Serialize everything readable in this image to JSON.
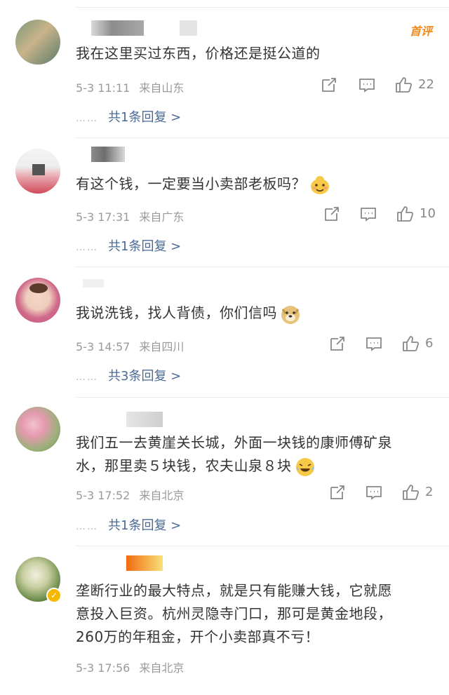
{
  "comments": [
    {
      "badge": "首评",
      "text": "我在这里买过东西，价格还是挺公道的",
      "date": "5-3 11:11",
      "location": "来自山东",
      "likes": "22",
      "reply_link": "共1条回复 >"
    },
    {
      "text": "有这个钱，一定要当小卖部老板吗？",
      "emoji": "smiling-face-emoji",
      "date": "5-3 17:31",
      "location": "来自广东",
      "likes": "10",
      "reply_link": "共1条回复 >"
    },
    {
      "text": "我说洗钱，找人背债，你们信吗",
      "emoji": "doge-emoji",
      "date": "5-3 14:57",
      "location": "来自四川",
      "likes": "6",
      "reply_link": "共3条回复 >"
    },
    {
      "text_line1": "我们五一去黄崖关长城，外面一块钱的康师傅矿泉",
      "text_line2": "水，那里卖５块钱，农夫山泉８块",
      "emoji": "laughing-tears-emoji",
      "date": "5-3 17:52",
      "location": "来自北京",
      "likes": "2",
      "reply_link": "共1条回复 >"
    },
    {
      "text_line1": "垄断行业的最大特点，就是只有能赚大钱，它就愿",
      "text_line2": "意投入巨资。杭州灵隐寺门口，那可是黄金地段，",
      "text_line3": "260万的年租金，开个小卖部真不亏！",
      "date": "5-3 17:56",
      "location": "来自北京"
    }
  ],
  "reply_dots": "……",
  "colors": {
    "link": "#4a6a96",
    "meta": "#9a9a9a",
    "badge": "#f08a1c"
  }
}
